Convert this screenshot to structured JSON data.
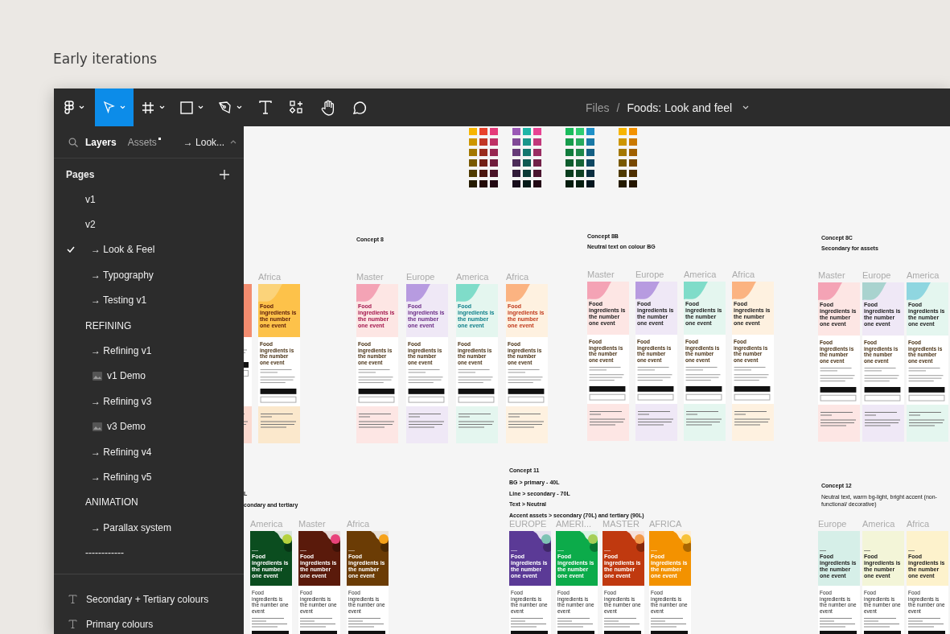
{
  "page_heading": "Early iterations",
  "toolbar": {
    "tools": [
      {
        "kind": "logo",
        "selected": false,
        "has_menu": true
      },
      {
        "kind": "move",
        "selected": true,
        "has_menu": true
      },
      {
        "kind": "frame",
        "selected": false,
        "has_menu": true
      },
      {
        "kind": "shape",
        "selected": false,
        "has_menu": true
      },
      {
        "kind": "pen",
        "selected": false,
        "has_menu": true
      },
      {
        "kind": "text",
        "selected": false,
        "has_menu": false
      },
      {
        "kind": "components",
        "selected": false,
        "has_menu": false
      },
      {
        "kind": "hand",
        "selected": false,
        "has_menu": false
      },
      {
        "kind": "comment",
        "selected": false,
        "has_menu": false
      }
    ],
    "breadcrumb": {
      "root": "Files",
      "separator": "/",
      "file": "Foods: Look and feel"
    }
  },
  "sidebar": {
    "tabs": [
      {
        "label": "Layers",
        "selected": true,
        "has_update": false
      },
      {
        "label": "Assets",
        "selected": false,
        "has_update": true
      }
    ],
    "page_switcher": "→ Look...",
    "pages_title": "Pages",
    "pages": [
      {
        "label": "v1",
        "kind": "plain",
        "selected": false
      },
      {
        "label": "v2",
        "kind": "plain",
        "selected": false
      },
      {
        "label": "→ Look & Feel",
        "kind": "sub",
        "selected": true
      },
      {
        "label": "→ Typography",
        "kind": "sub",
        "selected": false
      },
      {
        "label": "→ Testing v1",
        "kind": "sub",
        "selected": false
      },
      {
        "label": "REFINING",
        "kind": "plain",
        "selected": false
      },
      {
        "label": "→ Refining v1",
        "kind": "sub",
        "selected": false
      },
      {
        "label": "v1 Demo",
        "kind": "thumb",
        "selected": false
      },
      {
        "label": "→ Refining v3",
        "kind": "sub",
        "selected": false
      },
      {
        "label": "v3 Demo",
        "kind": "thumb",
        "selected": false
      },
      {
        "label": "→ Refining v4",
        "kind": "sub",
        "selected": false
      },
      {
        "label": "→ Refining v5",
        "kind": "sub",
        "selected": false
      },
      {
        "label": "ANIMATION",
        "kind": "plain",
        "selected": false
      },
      {
        "label": "→ Parallax system",
        "kind": "sub",
        "selected": false
      },
      {
        "label": "------------",
        "kind": "plain",
        "selected": false
      }
    ],
    "layers": [
      {
        "label": "Secondary + Tertiary colours"
      },
      {
        "label": "Primary colours"
      }
    ]
  },
  "canvas": {
    "groups": [
      {
        "kind": "pale",
        "cards": [
          {
            "color": "#fbd9cf",
            "header": {
              "color": "#f28c6f"
            }
          },
          {
            "label": "Africa",
            "color": "#fbe8cc",
            "header": {
              "color": "#fdc24a"
            },
            "blob": {
              "color": "#fbd37a"
            },
            "headline": {
              "text": "Food ingredients is the number one event",
              "color": "#5a1a0a"
            },
            "subheading": "Food ingredients is the number one event"
          }
        ]
      },
      {
        "title": "Concept 8",
        "kind": "pale",
        "cards": [
          {
            "label": "Master",
            "color": "#fde6e4",
            "blob": {
              "color": "#f4a3b5"
            },
            "headline": {
              "text": "Food ingredients is the number one event",
              "color": "#a3164d"
            },
            "subheading": "Food ingredients is the number one event"
          },
          {
            "label": "Europe",
            "color": "#efe8f6",
            "blob": {
              "color": "#b79be0"
            },
            "headline": {
              "text": "Food ingredients is the number one event",
              "color": "#6b2c86"
            },
            "subheading": "Food ingredients is the number one event"
          },
          {
            "label": "America",
            "color": "#e4f6ef",
            "blob": {
              "color": "#7fdcc9"
            },
            "headline": {
              "text": "Food ingredients is the number one event",
              "color": "#0f7f8a"
            },
            "subheading": "Food ingredients is the number one event"
          },
          {
            "label": "Africa",
            "color": "#fef1e0",
            "blob": {
              "color": "#fbb381"
            },
            "headline": {
              "text": "Food ingredients is the number one event",
              "color": "#c0391b"
            },
            "subheading": "Food ingredients is the number one event"
          }
        ]
      },
      {
        "title": "Concept 8B",
        "notes": [
          "Neutral text on colour BG"
        ],
        "kind": "pale",
        "cards": [
          {
            "label": "Master",
            "color": "#fde6e4",
            "blob": {
              "color": "#f4a3b5"
            },
            "headline": {
              "text": "Food ingredients is the number one event",
              "color": "#222222"
            },
            "subheading": "Food ingredients is the number one event"
          },
          {
            "label": "Europe",
            "color": "#efe8f6",
            "blob": {
              "color": "#b79be0"
            },
            "headline": {
              "text": "Food ingredients is the number one event",
              "color": "#222222"
            },
            "subheading": "Food ingredients is the number one event"
          },
          {
            "label": "America",
            "color": "#e4f6ef",
            "blob": {
              "color": "#7fdcc9"
            },
            "headline": {
              "text": "Food ingredients is the number one event",
              "color": "#222222"
            },
            "subheading": "Food ingredients is the number one event"
          },
          {
            "label": "Africa",
            "color": "#fef1e0",
            "blob": {
              "color": "#fbb381"
            },
            "headline": {
              "text": "Food ingredients is the number one event",
              "color": "#222222"
            },
            "subheading": "Food ingredients is the number one event"
          }
        ]
      },
      {
        "title": "Concept 8C",
        "notes": [
          "Secondary for assets"
        ],
        "kind": "pale",
        "cards": [
          {
            "label": "Master",
            "color": "#fde6e4",
            "blob": {
              "color": "#f4a3b5"
            },
            "headline": {
              "text": "Food ingredients is the number one event",
              "color": "#222222"
            },
            "subheading": "Food ingredients is the number one event"
          },
          {
            "label": "Europe",
            "color": "#efe8f6",
            "blob": {
              "color": "#a9d3cf"
            },
            "headline": {
              "text": "Food ingredients is the number one event",
              "color": "#222222"
            },
            "subheading": "Food ingredients is the number one event"
          },
          {
            "label": "America",
            "color": "#e4f6ef",
            "blob": {
              "color": "#8fd6e0"
            },
            "headline": {
              "text": "Food ingredients is the number one event",
              "color": "#222222"
            },
            "subheading": "Food ingredients is the number one event"
          }
        ]
      },
      {
        "notes": [
          "L",
          "condary and tertiary"
        ],
        "kind": "solid",
        "cards": [
          {
            "label": "America",
            "color": "#0b4d1f",
            "blob": {
              "color": "#b5d23e"
            },
            "headline": {
              "text": "Food ingredients is the number one event",
              "color": "#ffffff"
            },
            "subheading": "Food ingredients is the number one event"
          },
          {
            "label": "Master",
            "color": "#5a1a0b",
            "blob": {
              "color": "#e8437a"
            },
            "headline": {
              "text": "Food ingredients is the number one event",
              "color": "#ffffff"
            },
            "subheading": "Food ingredients is the number one event"
          },
          {
            "label": "Africa",
            "color": "#6b3c05",
            "blob": {
              "color": "#f6a21a"
            },
            "headline": {
              "text": "Food ingredients is the number one event",
              "color": "#ffffff"
            },
            "subheading": "Food ingredients is the number one event"
          }
        ]
      },
      {
        "title": "Concept 11",
        "notes": [
          "BG > primary - 40L",
          "Line > secondary - 70L",
          "Text > Neutral",
          "Accent assets >  secondary (70L) and tertiary (90L)"
        ],
        "kind": "solid",
        "cards": [
          {
            "label": "EUROPE",
            "color": "#5b3a96",
            "blob": {
              "color": "#7fc3b5"
            },
            "headline": {
              "text": "Food ingredients is the number one event",
              "color": "#ffffff"
            },
            "subheading": "Food ingredients is the number one event"
          },
          {
            "label": "AMERI...",
            "color": "#0cab4a",
            "blob": {
              "color": "#a5cf58"
            },
            "headline": {
              "text": "Food ingredients is the number one event",
              "color": "#ffffff"
            },
            "subheading": "Food ingredients is the number one event"
          },
          {
            "label": "MASTER",
            "color": "#c0390f",
            "blob": {
              "color": "#f39a4c"
            },
            "headline": {
              "text": "Food ingredients is the number one event",
              "color": "#ffffff"
            },
            "subheading": "Food ingredients is the number one event"
          },
          {
            "label": "AFRICA",
            "color": "#f39200",
            "blob": {
              "color": "#f7c23a"
            },
            "headline": {
              "text": "Food ingredients is the number one event",
              "color": "#ffffff"
            },
            "subheading": "Food ingredients is the number one event"
          }
        ]
      },
      {
        "title": "Concept 12",
        "notes": [
          "Neutral text, warm bg-light, bright accent (non-functional/ decorative)"
        ],
        "kind": "solid",
        "cards": [
          {
            "label": "Europe",
            "color": "#d6efe8",
            "headline": {
              "text": "Food ingredients is the number one event",
              "color": "#222222"
            },
            "subheading": "Food ingredients is the number one event"
          },
          {
            "label": "America",
            "color": "#f3f5d8",
            "headline": {
              "text": "Food ingredients is the number one event",
              "color": "#222222"
            },
            "subheading": "Food ingredients is the number one event"
          },
          {
            "label": "Africa",
            "color": "#fdf2cc",
            "headline": {
              "text": "Food ingredients is the number one event",
              "color": "#222222"
            },
            "subheading": "Food ingredients is the number one event"
          }
        ]
      }
    ]
  }
}
